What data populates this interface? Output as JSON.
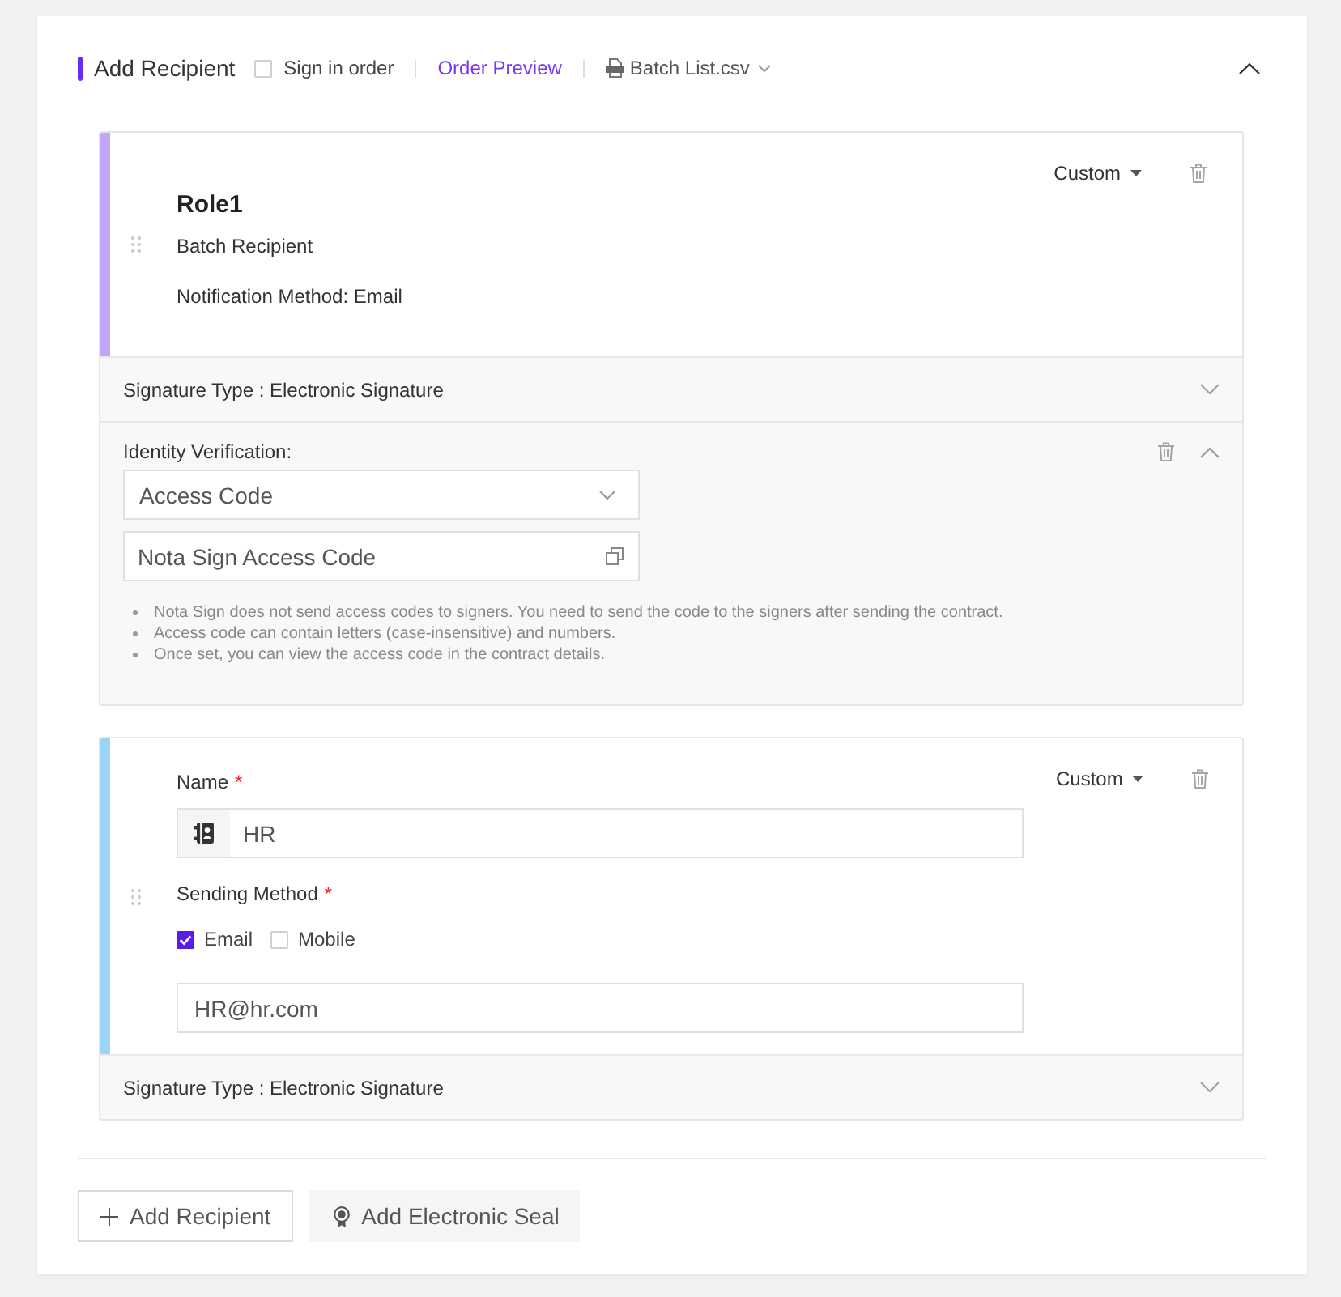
{
  "header": {
    "title": "Add Recipient",
    "sign_in_order": {
      "label": "Sign in order",
      "checked": false
    },
    "order_preview": "Order Preview",
    "batch_file": "Batch List.csv",
    "expanded": true
  },
  "recipients": [
    {
      "kind": "batch",
      "color": "#c4a6f8",
      "role": "Role1",
      "description": "Batch Recipient",
      "notification": "Notification Method: Email",
      "mode": "Custom",
      "signature": {
        "text": "Signature Type : Electronic Signature",
        "expanded": false
      },
      "identity": {
        "label": "Identity Verification:",
        "expanded": true,
        "method": "Access Code",
        "code": "Nota Sign Access Code",
        "notes": [
          "Nota Sign does not send access codes to signers. You need to send the code to the signers after sending the contract.",
          "Access code can contain letters (case-insensitive) and numbers.",
          "Once set, you can view the access code in the contract details."
        ]
      }
    },
    {
      "kind": "individual",
      "color": "#9ad4f8",
      "name": {
        "label": "Name",
        "required_mark": "*",
        "value": "HR"
      },
      "sending": {
        "label": "Sending Method",
        "required_mark": "*",
        "options": [
          {
            "label": "Email",
            "checked": true
          },
          {
            "label": "Mobile",
            "checked": false
          }
        ],
        "value": "HR@hr.com"
      },
      "mode": "Custom",
      "signature": {
        "text": "Signature Type : Electronic Signature",
        "expanded": false
      }
    }
  ],
  "actions": [
    {
      "kind": "add",
      "label": "Add Recipient"
    },
    {
      "kind": "seal",
      "label": "Add Electronic Seal"
    }
  ]
}
